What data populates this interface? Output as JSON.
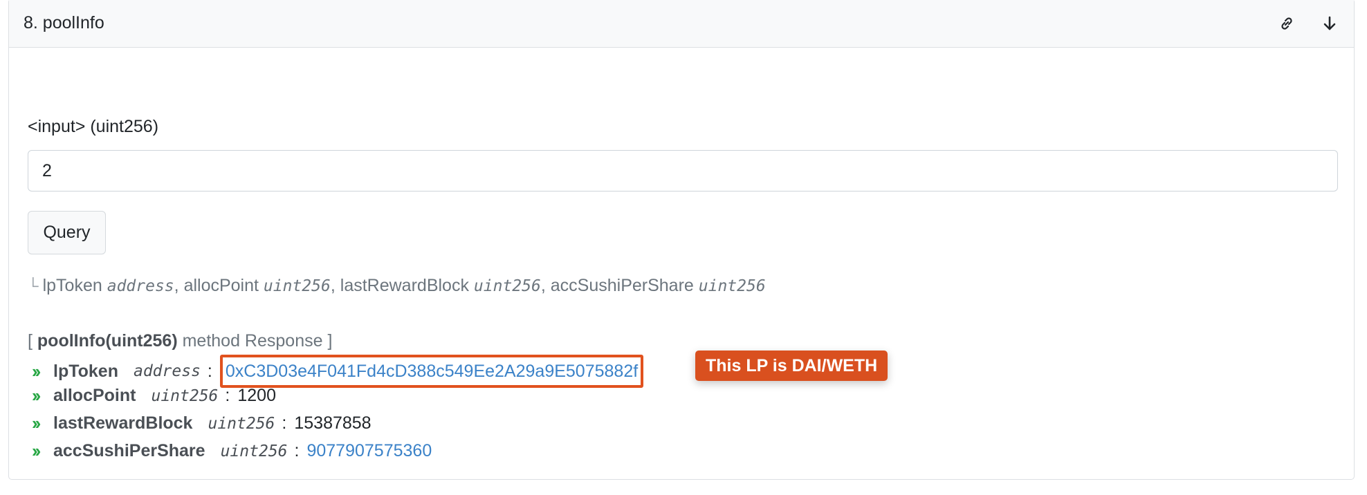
{
  "header": {
    "title": "8. poolInfo",
    "icons": [
      "link-icon",
      "arrow-down-icon"
    ]
  },
  "input": {
    "label": "<input> (uint256)",
    "value": "2"
  },
  "query_button": {
    "label": "Query"
  },
  "signature": [
    {
      "name": "lpToken",
      "type": "address",
      "sep": ", "
    },
    {
      "name": "allocPoint",
      "type": "uint256",
      "sep": ", "
    },
    {
      "name": "lastRewardBlock",
      "type": "uint256",
      "sep": ", "
    },
    {
      "name": "accSushiPerShare",
      "type": "uint256",
      "sep": ""
    }
  ],
  "response": {
    "open_bracket": "[ ",
    "method": "poolInfo(uint256)",
    "suffix": " method Response ]",
    "rows": [
      {
        "name": "lpToken",
        "type": "address",
        "value": "0xC3D03e4F041Fd4cD388c549Ee2A29a9E5075882f"
      },
      {
        "name": "allocPoint",
        "type": "uint256",
        "value": "1200"
      },
      {
        "name": "lastRewardBlock",
        "type": "uint256",
        "value": "15387858"
      },
      {
        "name": "accSushiPerShare",
        "type": "uint256",
        "value": "9077907575360"
      }
    ]
  },
  "annotation": {
    "text": "This LP is DAI/WETH",
    "color": "#d9501f"
  },
  "colors": {
    "accent_green": "#28a745",
    "link_blue": "#3b82c8",
    "highlight_border": "#e1521e"
  }
}
